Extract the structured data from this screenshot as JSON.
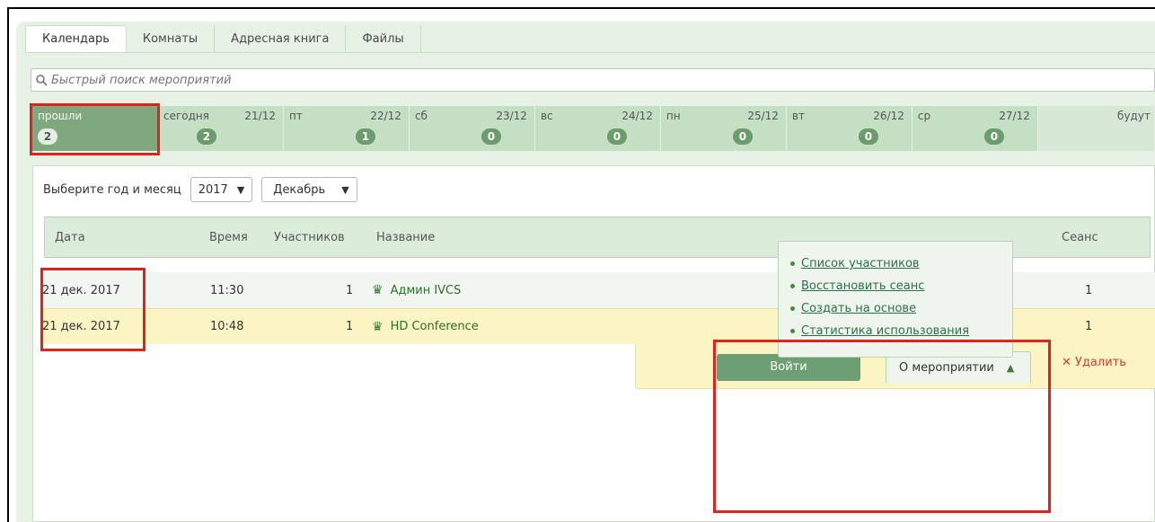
{
  "tabs": [
    "Календарь",
    "Комнаты",
    "Адресная книга",
    "Файлы"
  ],
  "search": {
    "placeholder": "Быстрый поиск мероприятий"
  },
  "days": [
    {
      "name": "прошли",
      "date": "",
      "count": "2"
    },
    {
      "name": "сегодня",
      "date": "21/12",
      "count": "2"
    },
    {
      "name": "пт",
      "date": "22/12",
      "count": "1"
    },
    {
      "name": "сб",
      "date": "23/12",
      "count": "0"
    },
    {
      "name": "вс",
      "date": "24/12",
      "count": "0"
    },
    {
      "name": "пн",
      "date": "25/12",
      "count": "0"
    },
    {
      "name": "вт",
      "date": "26/12",
      "count": "0"
    },
    {
      "name": "ср",
      "date": "27/12",
      "count": "0"
    },
    {
      "name": "будут",
      "date": "",
      "count": ""
    }
  ],
  "filter": {
    "label": "Выберите год и месяц",
    "year": "2017",
    "month": "Декабрь"
  },
  "table": {
    "headers": {
      "date": "Дата",
      "time": "Время",
      "participants": "Участников",
      "title": "Название",
      "session": "Сеанс"
    },
    "rows": [
      {
        "date": "21 дек. 2017",
        "time": "11:30",
        "participants": "1",
        "title": "Админ IVCS",
        "session": "1"
      },
      {
        "date": "21 дек. 2017",
        "time": "10:48",
        "participants": "1",
        "title": "HD Conference",
        "session": "1"
      }
    ]
  },
  "actions": {
    "join": "Войти",
    "about": "О мероприятии",
    "delete": "✕ Удалить"
  },
  "about_menu": [
    "Список участников",
    "Восстановить сеанс",
    "Создать на основе",
    "Статистика использования"
  ],
  "colors": {
    "accent_green": "#6e9f74",
    "highlight_red": "#e3221c",
    "selected_row": "#fbf4c3"
  }
}
